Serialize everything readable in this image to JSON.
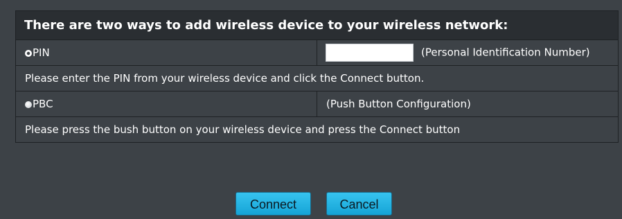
{
  "header": {
    "title": "There are two ways to add wireless device to your wireless network:"
  },
  "pin": {
    "label": "PIN",
    "selected": true,
    "input_value": "",
    "description": "(Personal Identification Number)",
    "instruction": "Please enter the PIN from your wireless device and click the Connect button."
  },
  "pbc": {
    "label": "PBC",
    "selected": false,
    "description": "(Push Button Configuration)",
    "instruction": "Please press the bush button on your wireless device and press the Connect button"
  },
  "buttons": {
    "connect_label": "Connect",
    "cancel_label": "Cancel"
  },
  "colors": {
    "background": "#3d4247",
    "header_background": "#2a2e32",
    "border": "#1e2124",
    "button": "#22b2e2"
  },
  "icons": {
    "pin_radio": "radio-selected-icon",
    "pbc_radio": "radio-unselected-icon"
  }
}
